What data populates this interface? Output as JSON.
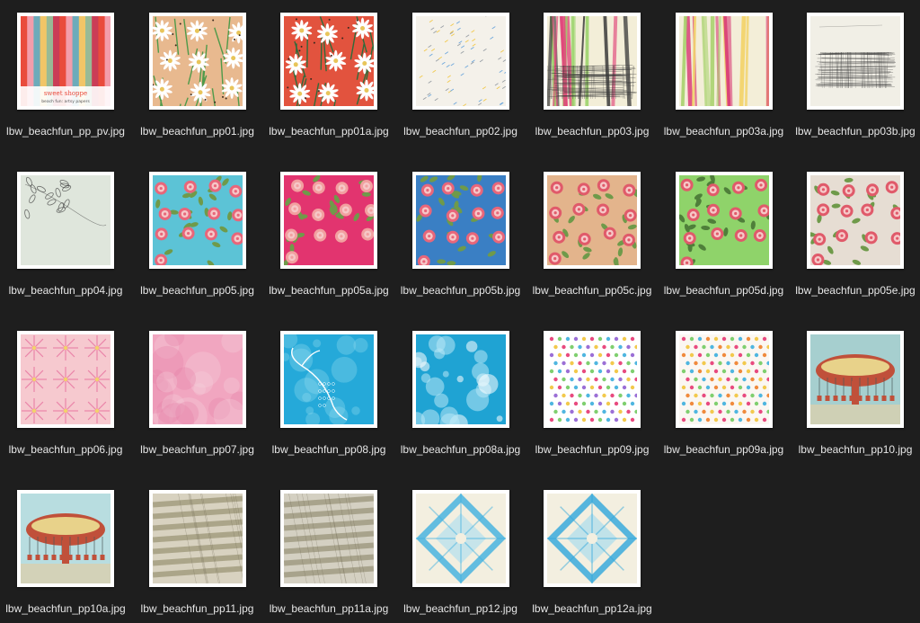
{
  "window": {
    "background": "#1e1e1e",
    "label_color": "#e6e6e6"
  },
  "files": [
    {
      "name": "lbw_beachfun_pp_pv.jpg",
      "pattern": "preview-stack",
      "colors": [
        "#e94b3c",
        "#f4a6b7",
        "#5fb6c8",
        "#f2d36b",
        "#8fc7a0",
        "#c63c5a"
      ],
      "caption": "sweet shoppe",
      "caption2": "beach fun: artsy papers"
    },
    {
      "name": "lbw_beachfun_pp01.jpg",
      "pattern": "daisies",
      "colors": [
        "#e8b98f",
        "#ffffff",
        "#4f9a4a",
        "#3b2a1e"
      ]
    },
    {
      "name": "lbw_beachfun_pp01a.jpg",
      "pattern": "daisies",
      "colors": [
        "#e2533e",
        "#ffffff",
        "#2f6b3a",
        "#3b2a1e"
      ]
    },
    {
      "name": "lbw_beachfun_pp02.jpg",
      "pattern": "sprinkles",
      "colors": [
        "#f4f1ea",
        "#9aa0a6",
        "#f2c94c",
        "#6fa8dc"
      ]
    },
    {
      "name": "lbw_beachfun_pp03.jpg",
      "pattern": "stripes-scribble",
      "colors": [
        "#f3eed8",
        "#e0457a",
        "#9bd36b",
        "#3a3a3a"
      ]
    },
    {
      "name": "lbw_beachfun_pp03a.jpg",
      "pattern": "stripes",
      "colors": [
        "#f3eed8",
        "#d93c77",
        "#a6d16b",
        "#f2d36b"
      ]
    },
    {
      "name": "lbw_beachfun_pp03b.jpg",
      "pattern": "scribble",
      "colors": [
        "#f1efe6",
        "#3a3a3a"
      ]
    },
    {
      "name": "lbw_beachfun_pp04.jpg",
      "pattern": "leaves-stamp",
      "colors": [
        "#dfe6dc",
        "#3c3c3c"
      ]
    },
    {
      "name": "lbw_beachfun_pp05.jpg",
      "pattern": "roses",
      "colors": [
        "#5cc3d6",
        "#e8667a",
        "#6f9a4a",
        "#f6c8c8"
      ]
    },
    {
      "name": "lbw_beachfun_pp05a.jpg",
      "pattern": "roses",
      "colors": [
        "#e2346f",
        "#f2a0a0",
        "#6f9a4a",
        "#f6c8c8"
      ]
    },
    {
      "name": "lbw_beachfun_pp05b.jpg",
      "pattern": "roses",
      "colors": [
        "#3a7fc4",
        "#e8667a",
        "#6f9a4a",
        "#f6c8c8"
      ]
    },
    {
      "name": "lbw_beachfun_pp05c.jpg",
      "pattern": "roses",
      "colors": [
        "#e3b48c",
        "#e05a6a",
        "#6f9a4a",
        "#f6c8c8"
      ]
    },
    {
      "name": "lbw_beachfun_pp05d.jpg",
      "pattern": "roses",
      "colors": [
        "#8fd36a",
        "#e05a6a",
        "#4f7f3a",
        "#f6c8c8"
      ]
    },
    {
      "name": "lbw_beachfun_pp05e.jpg",
      "pattern": "roses",
      "colors": [
        "#e6ddd3",
        "#e05a6a",
        "#6f9a4a",
        "#f6c8c8"
      ]
    },
    {
      "name": "lbw_beachfun_pp06.jpg",
      "pattern": "tiedye-star",
      "colors": [
        "#f6c9cf",
        "#e5689a",
        "#f2d36b",
        "#ffffff"
      ]
    },
    {
      "name": "lbw_beachfun_pp07.jpg",
      "pattern": "watercolor",
      "colors": [
        "#f1a6c0",
        "#e47fa6",
        "#f6d4df"
      ]
    },
    {
      "name": "lbw_beachfun_pp08.jpg",
      "pattern": "mermaid-tail",
      "colors": [
        "#25a9d9",
        "#8fd9ef",
        "#ffffff"
      ]
    },
    {
      "name": "lbw_beachfun_pp08a.jpg",
      "pattern": "splash",
      "colors": [
        "#1fa3d3",
        "#b8e8f5",
        "#ffffff"
      ]
    },
    {
      "name": "lbw_beachfun_pp09.jpg",
      "pattern": "dots",
      "colors": [
        "#ffffff",
        "#e84a7f",
        "#4fb6e0",
        "#f2c94c",
        "#7fcf6f",
        "#9b6fd6"
      ]
    },
    {
      "name": "lbw_beachfun_pp09a.jpg",
      "pattern": "dots",
      "colors": [
        "#fbf7f2",
        "#e84a7f",
        "#4fb6e0",
        "#f2c94c",
        "#7fcf6f",
        "#f08a3c"
      ]
    },
    {
      "name": "lbw_beachfun_pp10.jpg",
      "pattern": "carousel",
      "colors": [
        "#a6cfcf",
        "#c0503a",
        "#e8d28a",
        "#4a5a5a"
      ]
    },
    {
      "name": "lbw_beachfun_pp10a.jpg",
      "pattern": "carousel",
      "colors": [
        "#b8dde0",
        "#c0503a",
        "#e8d28a",
        "#4a5a5a"
      ]
    },
    {
      "name": "lbw_beachfun_pp11.jpg",
      "pattern": "grunge-stripes",
      "colors": [
        "#d8d2c0",
        "#9c9577",
        "#6c6650"
      ]
    },
    {
      "name": "lbw_beachfun_pp11a.jpg",
      "pattern": "grunge-stripes",
      "colors": [
        "#d4d0c2",
        "#9a9479",
        "#6c6650"
      ]
    },
    {
      "name": "lbw_beachfun_pp12.jpg",
      "pattern": "tiedye-kaleido",
      "colors": [
        "#f3efe0",
        "#3fb0e0",
        "#a8dcf0"
      ]
    },
    {
      "name": "lbw_beachfun_pp12a.jpg",
      "pattern": "tiedye-kaleido",
      "colors": [
        "#f3efe0",
        "#2ea6dc",
        "#9fd8ef"
      ]
    }
  ]
}
